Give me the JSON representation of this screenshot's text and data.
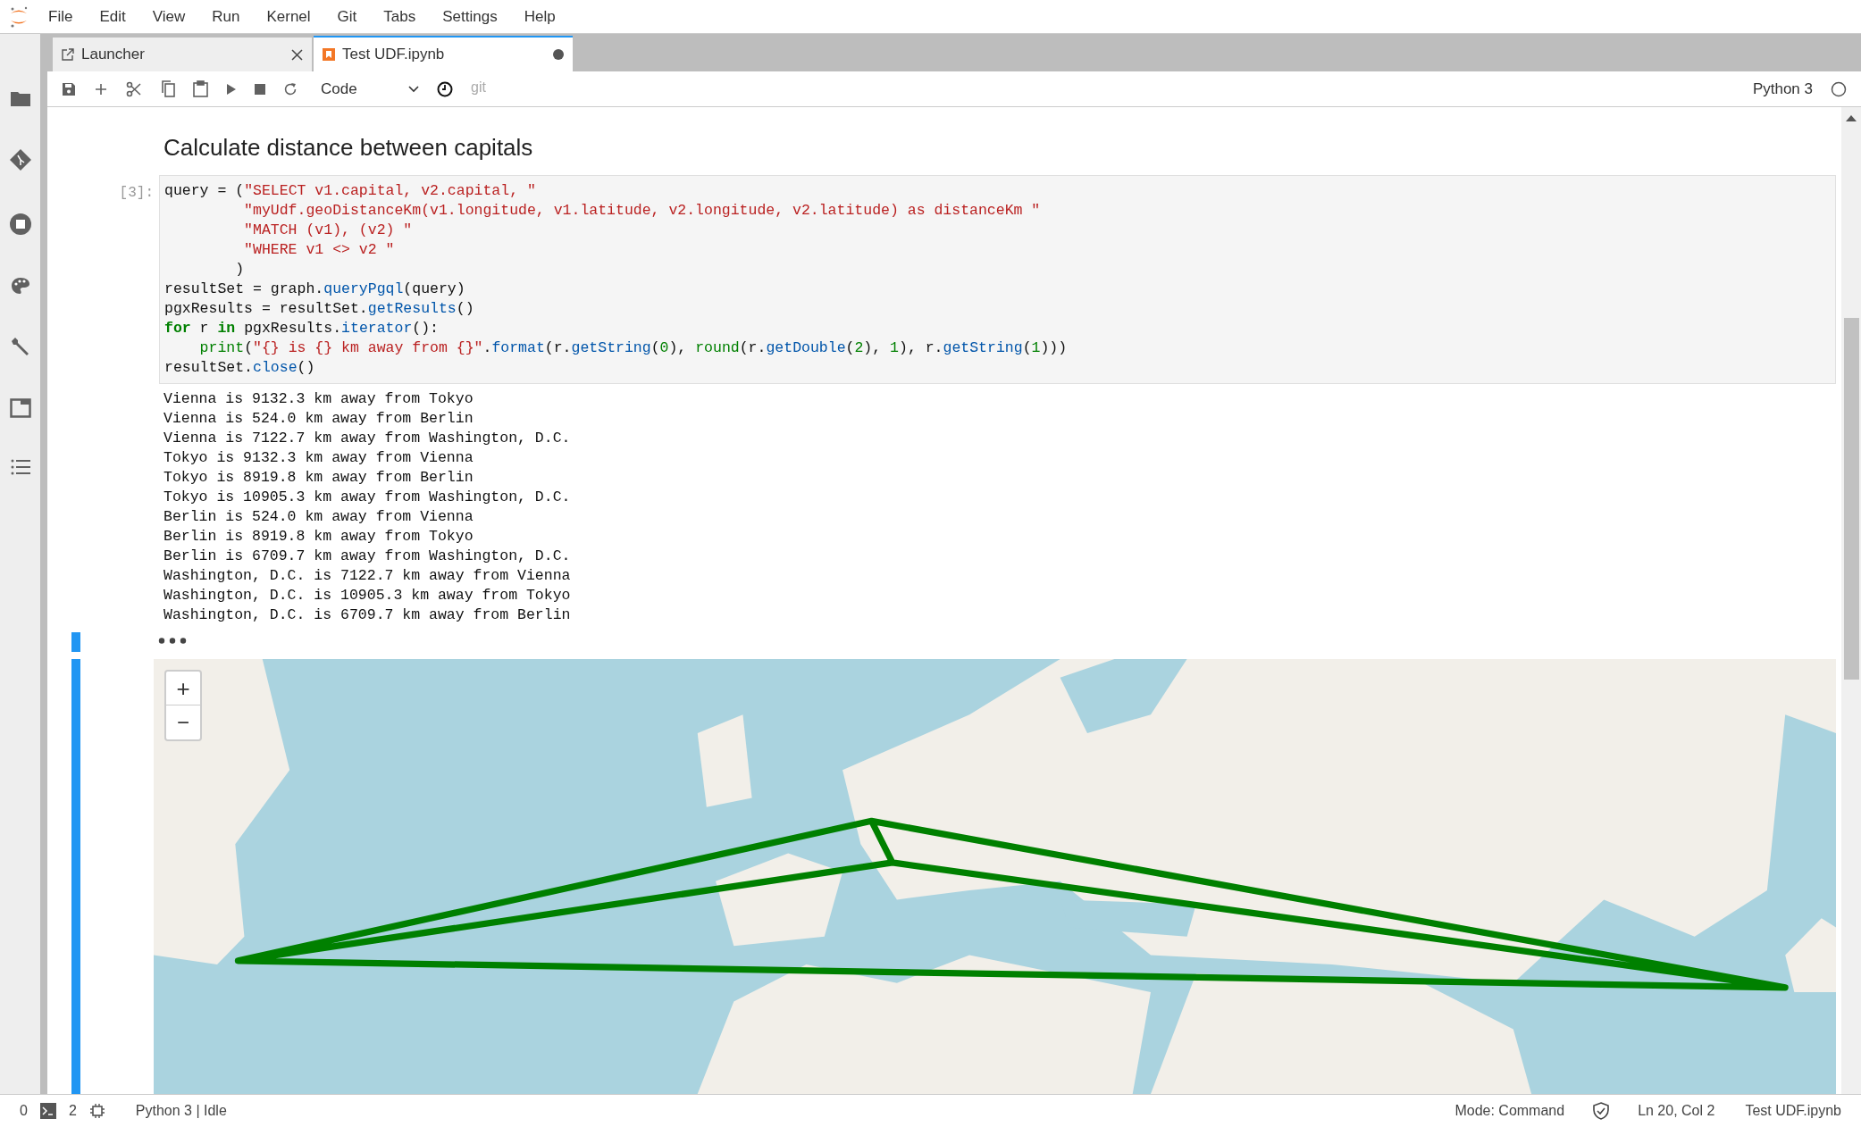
{
  "menu": [
    "File",
    "Edit",
    "View",
    "Run",
    "Kernel",
    "Git",
    "Tabs",
    "Settings",
    "Help"
  ],
  "tabs": [
    {
      "label": "Launcher",
      "selected": false,
      "kind": "launcher",
      "modified": false
    },
    {
      "label": "Test UDF.ipynb",
      "selected": true,
      "kind": "notebook",
      "modified": true
    }
  ],
  "toolbar": {
    "cell_type": "Code",
    "git_label": "git",
    "kernel": "Python 3"
  },
  "heading": "Calculate distance between capitals",
  "cell": {
    "prompt": "[3]:",
    "lines": [
      [
        {
          "kind": "plain",
          "text": "query = ("
        },
        {
          "kind": "string",
          "text": "\"SELECT v1.capital, v2.capital, \""
        }
      ],
      [
        {
          "kind": "string",
          "text": "         \"myUdf.geoDistanceKm(v1.longitude, v1.latitude, v2.longitude, v2.latitude) as distanceKm \""
        }
      ],
      [
        {
          "kind": "string",
          "text": "         \"MATCH (v1), (v2) \""
        }
      ],
      [
        {
          "kind": "string",
          "text": "         \"WHERE v1 <> v2 \""
        }
      ],
      [
        {
          "kind": "plain",
          "text": "        )"
        }
      ],
      [
        {
          "kind": "plain",
          "text": "resultSet = graph."
        },
        {
          "kind": "func",
          "text": "queryPgql"
        },
        {
          "kind": "plain",
          "text": "(query)"
        }
      ],
      [
        {
          "kind": "plain",
          "text": "pgxResults = resultSet."
        },
        {
          "kind": "func",
          "text": "getResults"
        },
        {
          "kind": "plain",
          "text": "()"
        }
      ],
      [
        {
          "kind": "keyword",
          "text": "for"
        },
        {
          "kind": "plain",
          "text": " r "
        },
        {
          "kind": "keyword",
          "text": "in"
        },
        {
          "kind": "plain",
          "text": " pgxResults."
        },
        {
          "kind": "func",
          "text": "iterator"
        },
        {
          "kind": "plain",
          "text": "():"
        }
      ],
      [
        {
          "kind": "builtin",
          "text": "    print"
        },
        {
          "kind": "plain",
          "text": "("
        },
        {
          "kind": "string",
          "text": "\"{} is {} km away from {}\""
        },
        {
          "kind": "plain",
          "text": "."
        },
        {
          "kind": "func",
          "text": "format"
        },
        {
          "kind": "plain",
          "text": "(r."
        },
        {
          "kind": "func",
          "text": "getString"
        },
        {
          "kind": "plain",
          "text": "("
        },
        {
          "kind": "number",
          "text": "0"
        },
        {
          "kind": "plain",
          "text": "), "
        },
        {
          "kind": "builtin",
          "text": "round"
        },
        {
          "kind": "plain",
          "text": "(r."
        },
        {
          "kind": "func",
          "text": "getDouble"
        },
        {
          "kind": "plain",
          "text": "("
        },
        {
          "kind": "number",
          "text": "2"
        },
        {
          "kind": "plain",
          "text": "), "
        },
        {
          "kind": "number",
          "text": "1"
        },
        {
          "kind": "plain",
          "text": "), r."
        },
        {
          "kind": "func",
          "text": "getString"
        },
        {
          "kind": "plain",
          "text": "("
        },
        {
          "kind": "number",
          "text": "1"
        },
        {
          "kind": "plain",
          "text": ")))"
        }
      ],
      [
        {
          "kind": "plain",
          "text": "resultSet."
        },
        {
          "kind": "func",
          "text": "close"
        },
        {
          "kind": "plain",
          "text": "()"
        }
      ]
    ]
  },
  "output": [
    "Vienna is 9132.3 km away from Tokyo",
    "Vienna is 524.0 km away from Berlin",
    "Vienna is 7122.7 km away from Washington, D.C.",
    "Tokyo is 9132.3 km away from Vienna",
    "Tokyo is 8919.8 km away from Berlin",
    "Tokyo is 10905.3 km away from Washington, D.C.",
    "Berlin is 524.0 km away from Vienna",
    "Berlin is 8919.8 km away from Tokyo",
    "Berlin is 6709.7 km away from Washington, D.C.",
    "Washington, D.C. is 7122.7 km away from Vienna",
    "Washington, D.C. is 10905.3 km away from Tokyo",
    "Washington, D.C. is 6709.7 km away from Berlin"
  ],
  "map": {
    "zoom_in": "+",
    "zoom_out": "−"
  },
  "status_bar": {
    "terminals": "0",
    "kernels": "2",
    "kernel_status": "Python 3 | Idle",
    "mode": "Mode: Command",
    "position": "Ln 20, Col 2",
    "file": "Test UDF.ipynb"
  }
}
